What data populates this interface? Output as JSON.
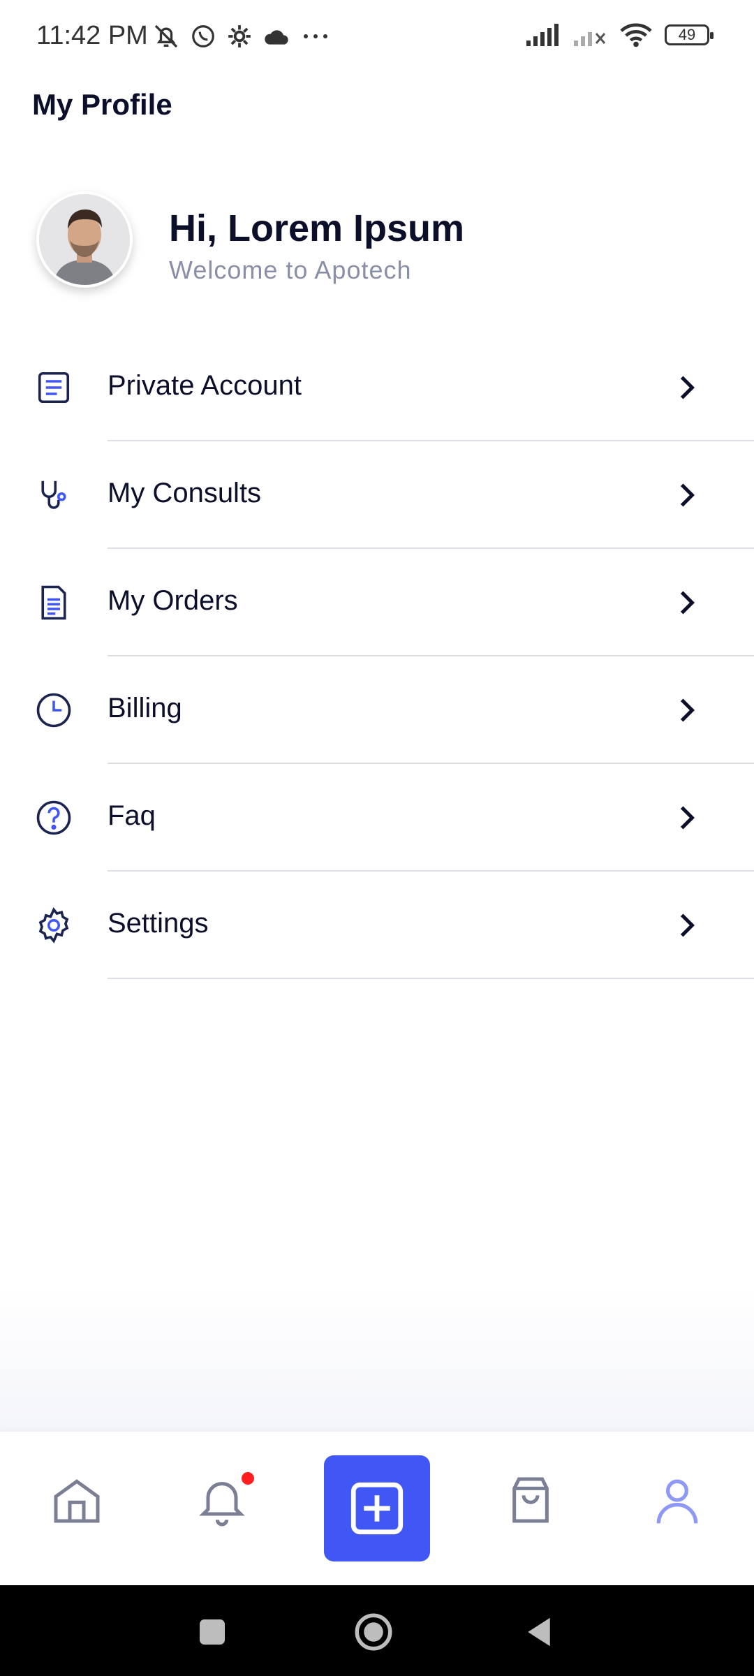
{
  "status": {
    "time": "11:42 PM",
    "battery": "49"
  },
  "header": {
    "title": "My Profile"
  },
  "profile": {
    "greeting": "Hi, Lorem Ipsum",
    "subtitle": "Welcome to Apotech"
  },
  "menu": {
    "items": [
      {
        "label": "Private Account",
        "icon": "document-list-icon"
      },
      {
        "label": "My Consults",
        "icon": "stethoscope-icon"
      },
      {
        "label": "My Orders",
        "icon": "receipt-icon"
      },
      {
        "label": "Billing",
        "icon": "clock-icon"
      },
      {
        "label": "Faq",
        "icon": "help-circle-icon"
      },
      {
        "label": "Settings",
        "icon": "gear-icon"
      }
    ]
  },
  "bottom_nav": {
    "items": [
      "home-icon",
      "bell-icon",
      "add-icon",
      "shopping-bag-icon",
      "profile-icon"
    ],
    "active": "profile-icon",
    "accent_color": "#4057f5",
    "badge_color": "#ff1f1f"
  }
}
